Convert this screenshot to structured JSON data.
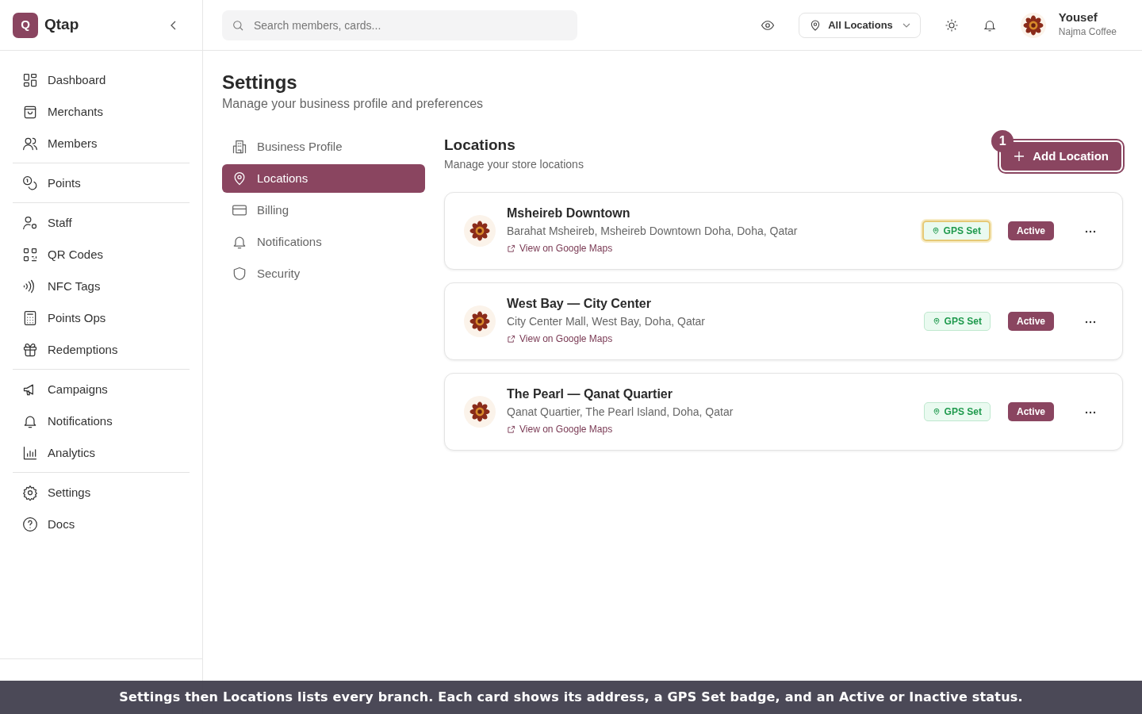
{
  "brand": {
    "logo_letter": "Q",
    "name": "Qtap"
  },
  "sidebar": {
    "groups": [
      [
        {
          "label": "Dashboard",
          "selected": false
        },
        {
          "label": "Merchants",
          "selected": false
        },
        {
          "label": "Members",
          "selected": false
        }
      ],
      [
        {
          "label": "Points",
          "selected": false
        }
      ],
      [
        {
          "label": "Staff",
          "selected": false
        },
        {
          "label": "QR Codes",
          "selected": false
        },
        {
          "label": "NFC Tags",
          "selected": false
        },
        {
          "label": "Points Ops",
          "selected": false
        },
        {
          "label": "Redemptions",
          "selected": false
        }
      ],
      [
        {
          "label": "Campaigns",
          "selected": false
        },
        {
          "label": "Notifications",
          "selected": false
        },
        {
          "label": "Analytics",
          "selected": false
        }
      ],
      [
        {
          "label": "Settings",
          "selected": false
        },
        {
          "label": "Docs",
          "selected": false
        }
      ]
    ]
  },
  "header": {
    "search": {
      "placeholder": "Search members, cards..."
    },
    "location_select": "All Locations",
    "user": {
      "name": "Yousef",
      "business": "Najma Coffee"
    }
  },
  "page": {
    "title": "Settings",
    "subtitle": "Manage your business profile and preferences"
  },
  "settings_menu": [
    {
      "label": "Business Profile",
      "selected": false
    },
    {
      "label": "Locations",
      "selected": true
    },
    {
      "label": "Billing",
      "selected": false
    },
    {
      "label": "Notifications",
      "selected": false
    },
    {
      "label": "Security",
      "selected": false
    }
  ],
  "section": {
    "title": "Locations",
    "subtitle": "Manage your store locations",
    "add_button": {
      "label": "Add Location",
      "highlighted": true,
      "step": "1"
    }
  },
  "locations": [
    {
      "name": "Msheireb Downtown",
      "address": "Barahat Msheireb, Msheireb Downtown Doha, Doha, Qatar",
      "link": "View on Google Maps",
      "gps": "GPS Set",
      "gps_highlighted": true,
      "status": "Active"
    },
    {
      "name": "West Bay — City Center",
      "address": "City Center Mall, West Bay, Doha, Qatar",
      "link": "View on Google Maps",
      "gps": "GPS Set",
      "gps_highlighted": false,
      "status": "Active"
    },
    {
      "name": "The Pearl — Qanat Quartier",
      "address": "Qanat Quartier, The Pearl Island, Doha, Qatar",
      "link": "View on Google Maps",
      "gps": "GPS Set",
      "gps_highlighted": false,
      "status": "Active"
    }
  ],
  "caption": "Settings then Locations lists every branch. Each card shows its address, a GPS Set badge, and an Active or Inactive status."
}
